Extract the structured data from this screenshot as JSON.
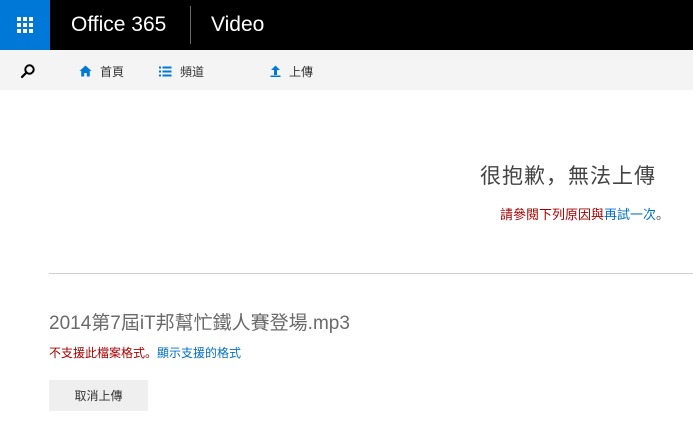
{
  "header": {
    "suite_title": "Office 365",
    "app_title": "Video",
    "accent_color": "#0078d7"
  },
  "nav": {
    "home_label": "首頁",
    "channels_label": "頻道",
    "upload_label": "上傳"
  },
  "error": {
    "title": "很抱歉，無法上傳",
    "subtitle_prefix": "請參閱下列原因與",
    "retry_link": "再試一次",
    "subtitle_suffix": "。"
  },
  "file": {
    "name": "2014第7屆iT邦幫忙鐵人賽登場.mp3",
    "error_text": "不支援此檔案格式。",
    "formats_link": "顯示支援的格式"
  },
  "actions": {
    "cancel_label": "取消上傳"
  }
}
